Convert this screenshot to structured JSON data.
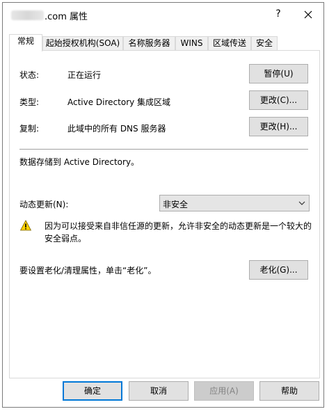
{
  "window": {
    "title_suffix": ".com 属性",
    "help_label": "?"
  },
  "tabs": [
    {
      "label": "常规"
    },
    {
      "label": "起始授权机构(SOA)"
    },
    {
      "label": "名称服务器"
    },
    {
      "label": "WINS"
    },
    {
      "label": "区域传送"
    },
    {
      "label": "安全"
    }
  ],
  "general": {
    "status_label": "状态:",
    "status_value": "正在运行",
    "pause_button": "暂停(U)",
    "type_label": "类型:",
    "type_value": "Active Directory 集成区域",
    "type_change_button": "更改(C)...",
    "replication_label": "复制:",
    "replication_value": "此域中的所有 DNS 服务器",
    "replication_change_button": "更改(H)...",
    "storage_text": "数据存储到 Active Directory。",
    "dynamic_update_label": "动态更新(N):",
    "dynamic_update_value": "非安全",
    "warning_line1": "因为可以接受来自非信任源的更新，允许非安全的动态更新是一个较大的",
    "warning_line2": "安全弱点。",
    "aging_text": "要设置老化/清理属性，单击“老化”。",
    "aging_button": "老化(G)..."
  },
  "footer": {
    "ok": "确定",
    "cancel": "取消",
    "apply": "应用(A)",
    "help": "帮助"
  },
  "colors": {
    "default_button_border": "#0078d7",
    "warning_yellow": "#ffd200"
  }
}
